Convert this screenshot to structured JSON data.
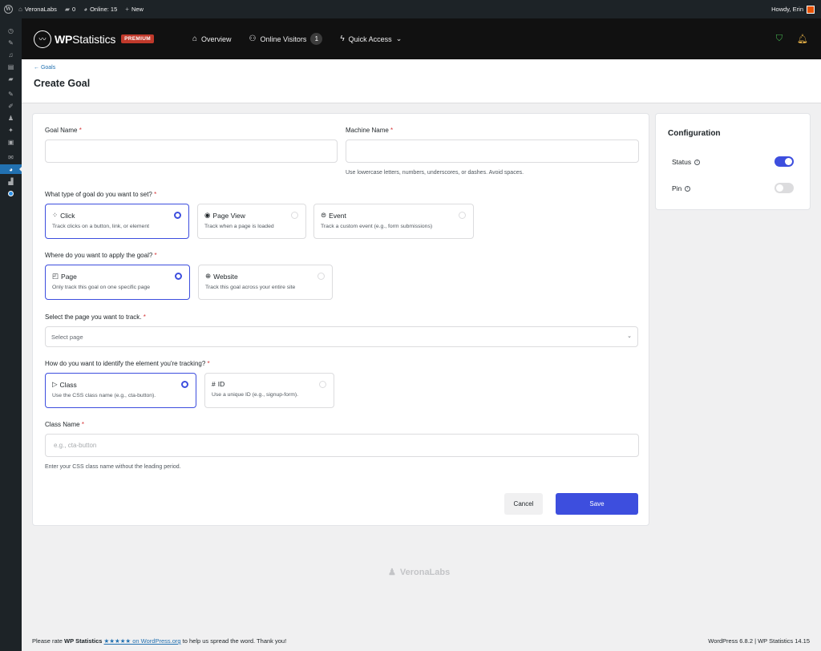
{
  "adminbar": {
    "site_name": "VeronaLabs",
    "comments_count": "0",
    "online": "Online: 15",
    "new_label": "New",
    "greeting": "Howdy, Erin"
  },
  "wps_header": {
    "brand": "WPStatistics",
    "brand_bold": "WP",
    "brand_light": "Statistics",
    "premium_badge": "PREMIUM",
    "nav": {
      "overview": "Overview",
      "online_visitors": "Online Visitors",
      "online_count": "1",
      "quick_access": "Quick Access"
    }
  },
  "page": {
    "back_link": "← Goals",
    "title": "Create Goal"
  },
  "form": {
    "goal_name_label": "Goal Name",
    "machine_name_label": "Machine Name",
    "machine_name_hint": "Use lowercase letters, numbers, underscores, or dashes. Avoid spaces.",
    "goal_type_label": "What type of goal do you want to set?",
    "goal_types": [
      {
        "title": "Click",
        "desc": "Track clicks on a button, link, or element",
        "selected": true
      },
      {
        "title": "Page View",
        "desc": "Track when a page is loaded",
        "selected": false
      },
      {
        "title": "Event",
        "desc": "Track a custom event (e.g., form submissions)",
        "selected": false
      }
    ],
    "apply_label": "Where do you want to apply the goal?",
    "apply_options": [
      {
        "title": "Page",
        "desc": "Only track this goal on one specific page",
        "selected": true
      },
      {
        "title": "Website",
        "desc": "Track this goal across your entire site",
        "selected": false
      }
    ],
    "select_page_label": "Select the page you want to track.",
    "select_page_placeholder": "Select page",
    "identify_label": "How do you want to identify the element you're tracking?",
    "identify_options": [
      {
        "title": "Class",
        "desc": "Use the CSS class name (e.g., cta-button).",
        "selected": true
      },
      {
        "title": "ID",
        "desc": "Use a unique ID (e.g., signup-form).",
        "selected": false
      }
    ],
    "class_name_label": "Class Name",
    "class_name_placeholder": "e.g., cta-button",
    "class_name_hint": "Enter your CSS class name without the leading period.",
    "cancel_label": "Cancel",
    "save_label": "Save",
    "required_mark": "*"
  },
  "config": {
    "title": "Configuration",
    "status_label": "Status",
    "status_on": true,
    "pin_label": "Pin",
    "pin_on": false
  },
  "footer": {
    "logo": "VeronaLabs",
    "rate_prefix": "Please rate",
    "rate_plugin": "WP Statistics",
    "rate_link": "★★★★★ on WordPress.org",
    "rate_suffix": "to help us spread the word. Thank you!",
    "version": "WordPress 6.8.2 | WP Statistics 14.15"
  },
  "colors": {
    "accent": "#3d4ede",
    "required": "#d63638",
    "premium": "#c0392b",
    "header_bg": "#111111"
  }
}
